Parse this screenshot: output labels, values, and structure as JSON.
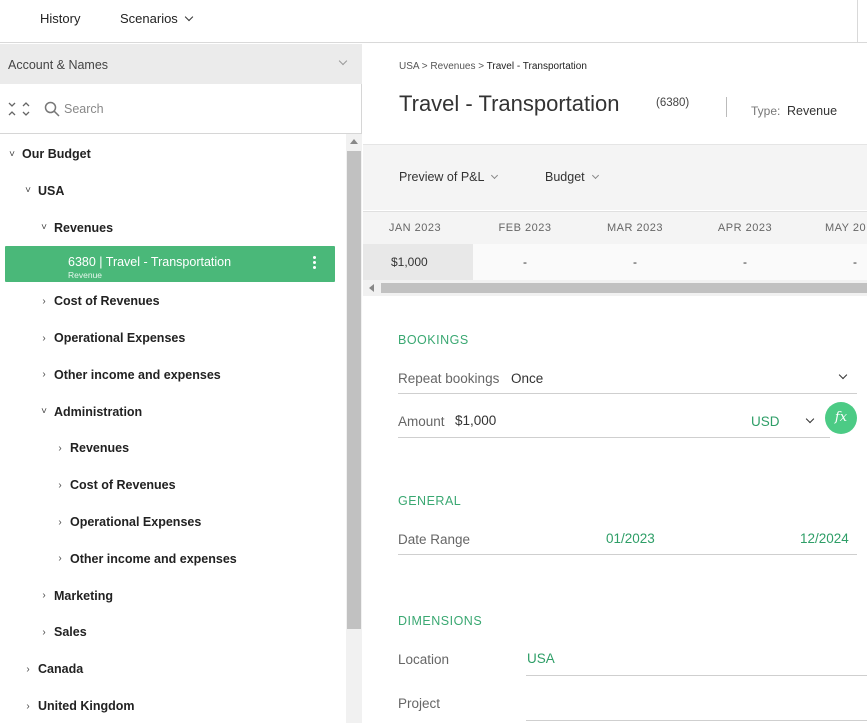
{
  "topbar": {
    "history": "History",
    "scenarios": "Scenarios"
  },
  "left": {
    "header": "Account & Names",
    "search_placeholder": "Search",
    "tree": [
      {
        "label": "Our Budget",
        "level": 0,
        "state": "expanded"
      },
      {
        "label": "USA",
        "level": 1,
        "state": "expanded"
      },
      {
        "label": "Revenues",
        "level": 2,
        "state": "expanded"
      },
      {
        "label": "6380 | Travel - Transportation",
        "sub": "Revenue",
        "level": 3,
        "state": "selected"
      },
      {
        "label": "Cost of Revenues",
        "level": 2,
        "state": "collapsed"
      },
      {
        "label": "Operational Expenses",
        "level": 2,
        "state": "collapsed"
      },
      {
        "label": "Other income and expenses",
        "level": 2,
        "state": "collapsed"
      },
      {
        "label": "Administration",
        "level": 2,
        "state": "expanded"
      },
      {
        "label": "Revenues",
        "level": 3,
        "state": "collapsed"
      },
      {
        "label": "Cost of Revenues",
        "level": 3,
        "state": "collapsed"
      },
      {
        "label": "Operational Expenses",
        "level": 3,
        "state": "collapsed"
      },
      {
        "label": "Other income and expenses",
        "level": 3,
        "state": "collapsed"
      },
      {
        "label": "Marketing",
        "level": 2,
        "state": "collapsed"
      },
      {
        "label": "Sales",
        "level": 2,
        "state": "collapsed"
      },
      {
        "label": "Canada",
        "level": 1,
        "state": "collapsed"
      },
      {
        "label": "United Kingdom",
        "level": 1,
        "state": "collapsed"
      }
    ]
  },
  "main": {
    "breadcrumb": [
      "USA",
      "Revenues",
      "Travel - Transportation"
    ],
    "breadcrumb_sep": " > ",
    "title": "Travel - Transportation",
    "account_number": "(6380)",
    "type_label": "Type:",
    "type_value": "Revenue",
    "preview_dropdown": "Preview of P&L",
    "budget_dropdown": "Budget",
    "months": [
      "JAN 2023",
      "FEB 2023",
      "MAR 2023",
      "APR 2023",
      "MAY 20"
    ],
    "month_values": [
      "$1,000",
      "-",
      "-",
      "-",
      "-"
    ],
    "bookings": {
      "section": "BOOKINGS",
      "repeat_label": "Repeat bookings",
      "repeat_value": "Once",
      "amount_label": "Amount",
      "amount_value": "$1,000",
      "currency": "USD",
      "fx_label": "fx"
    },
    "general": {
      "section": "GENERAL",
      "date_range_label": "Date Range",
      "date_from": "01/2023",
      "date_to": "12/2024"
    },
    "dimensions": {
      "section": "DIMENSIONS",
      "location_label": "Location",
      "location_value": "USA",
      "project_label": "Project"
    }
  },
  "colors": {
    "accent_green": "#4ab879",
    "section_green": "#3aa872",
    "fx_button": "#4ccb85"
  }
}
